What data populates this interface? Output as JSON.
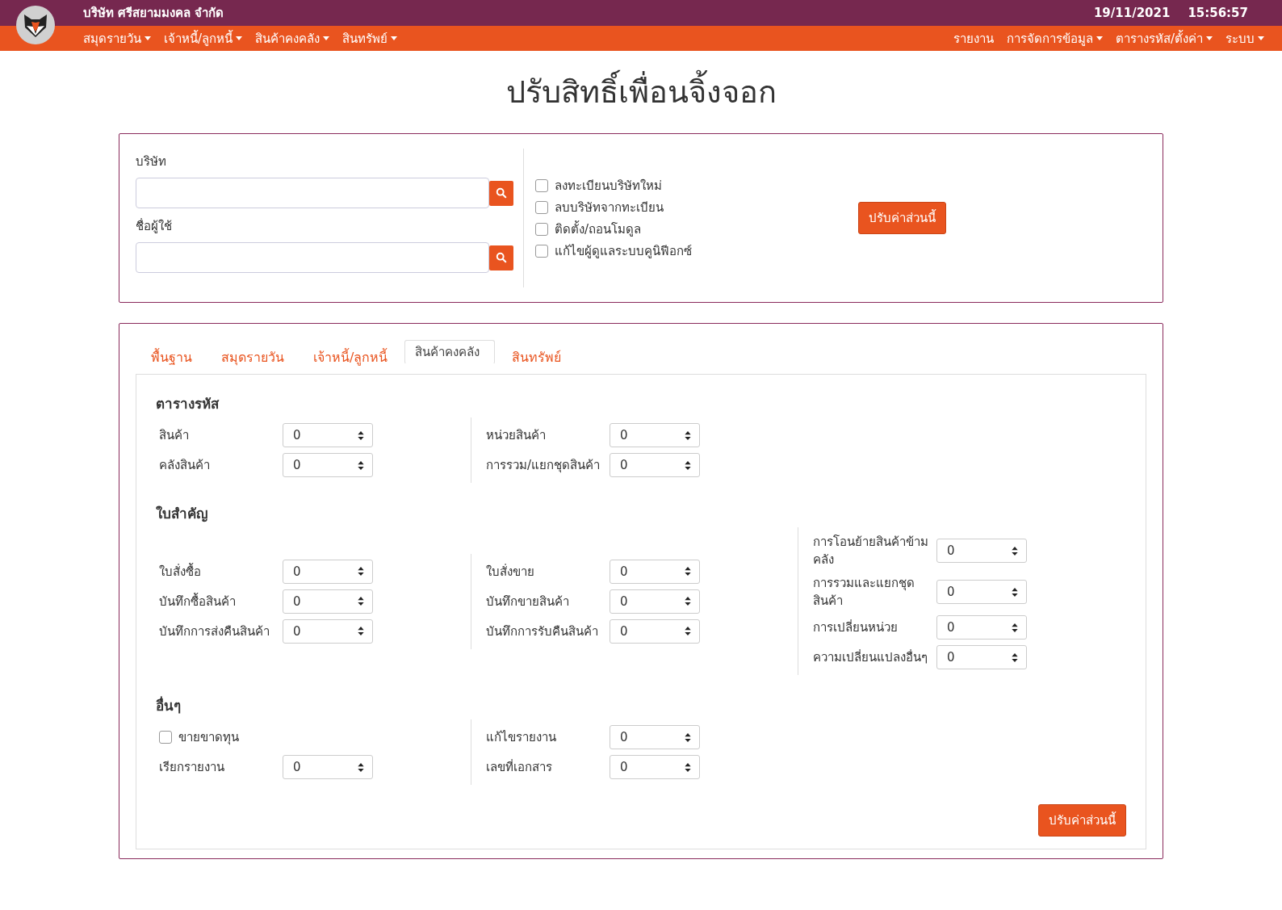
{
  "header": {
    "company": "บริษัท ศรีสยามมงคล จำกัด",
    "date": "19/11/2021",
    "time": "15:56:57"
  },
  "nav_left": [
    {
      "label": "สมุดรายวัน",
      "dropdown": true
    },
    {
      "label": "เจ้าหนี้/ลูกหนี้",
      "dropdown": true
    },
    {
      "label": "สินค้าคงคลัง",
      "dropdown": true
    },
    {
      "label": "สินทรัพย์",
      "dropdown": true
    }
  ],
  "nav_right": [
    {
      "label": "รายงาน",
      "dropdown": false
    },
    {
      "label": "การจัดการข้อมูล",
      "dropdown": true
    },
    {
      "label": "ตารางรหัส/ตั้งค่า",
      "dropdown": true
    },
    {
      "label": "ระบบ",
      "dropdown": true
    }
  ],
  "page_title": "ปรับสิทธิ์เพื่อนจิ้งจอก",
  "search_fields": [
    {
      "label": "บริษัท"
    },
    {
      "label": "ชื่อผู้ใช้"
    }
  ],
  "options": [
    {
      "label": "ลงทะเบียนบริษัทใหม่",
      "checked": false
    },
    {
      "label": "ลบบริษัทจากทะเบียน",
      "checked": false
    },
    {
      "label": "ติดตั้ง/ถอนโมดูล",
      "checked": false
    },
    {
      "label": "แก้ไขผู้ดูแลระบบคูนิฟีอกซ์",
      "checked": false
    }
  ],
  "top_apply_button": "ปรับค่าส่วนนี้",
  "tabs": [
    {
      "label": "พื้นฐาน",
      "selected": false
    },
    {
      "label": "สมุดรายวัน",
      "selected": false
    },
    {
      "label": "เจ้าหนี้/ลูกหนี้",
      "selected": false
    },
    {
      "label": "สินค้าคงคลัง",
      "selected": true
    },
    {
      "label": "สินทรัพย์",
      "selected": false
    }
  ],
  "sections": [
    {
      "title": "ตารางรหัส",
      "columns": [
        [
          {
            "kind": "select",
            "label": "สินค้า",
            "value": "0"
          },
          {
            "kind": "select",
            "label": "คลังสินค้า",
            "value": "0"
          }
        ],
        [
          {
            "kind": "select",
            "label": "หน่วยสินค้า",
            "value": "0"
          },
          {
            "kind": "select",
            "label": "การรวม/แยกชุดสินค้า",
            "value": "0"
          }
        ]
      ]
    },
    {
      "title": "ใบสำคัญ",
      "columns": [
        [
          {
            "kind": "select",
            "label": "ใบสั่งซื้อ",
            "value": "0"
          },
          {
            "kind": "select",
            "label": "บันทึกซื้อสินค้า",
            "value": "0"
          },
          {
            "kind": "select",
            "label": "บันทึกการส่งคืนสินค้า",
            "value": "0"
          }
        ],
        [
          {
            "kind": "select",
            "label": "ใบสั่งขาย",
            "value": "0"
          },
          {
            "kind": "select",
            "label": "บันทึกขายสินค้า",
            "value": "0"
          },
          {
            "kind": "select",
            "label": "บันทึกการรับคืนสินค้า",
            "value": "0"
          }
        ],
        [
          {
            "kind": "select",
            "label": "การโอนย้ายสินค้าข้ามคลัง",
            "value": "0"
          },
          {
            "kind": "select",
            "label": "การรวมและแยกชุดสินค้า",
            "value": "0"
          },
          {
            "kind": "select",
            "label": "การเปลี่ยนหน่วย",
            "value": "0"
          },
          {
            "kind": "select",
            "label": "ความเปลี่ยนแปลงอื่นๆ",
            "value": "0"
          }
        ]
      ]
    },
    {
      "title": "อื่นๆ",
      "columns": [
        [
          {
            "kind": "checkbox",
            "label": "ขายขาดทุน",
            "checked": false
          },
          {
            "kind": "select",
            "label": "เรียกรายงาน",
            "value": "0"
          }
        ],
        [
          {
            "kind": "select",
            "label": "แก้ไขรายงาน",
            "value": "0"
          },
          {
            "kind": "select",
            "label": "เลขที่เอกสาร",
            "value": "0"
          }
        ]
      ]
    }
  ],
  "bottom_apply_button": "ปรับค่าส่วนนี้"
}
